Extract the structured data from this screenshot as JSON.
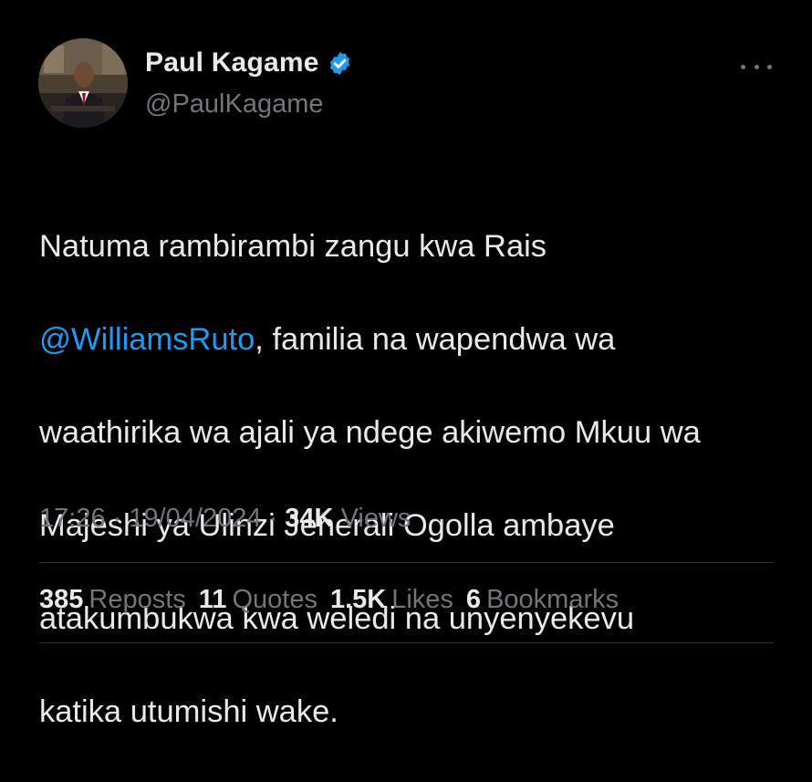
{
  "author": {
    "display_name": "Paul Kagame",
    "handle": "@PaulKagame",
    "verified_icon": "verified-badge-icon",
    "avatar_icon": "profile-photo"
  },
  "tweet": {
    "lines": [
      {
        "before": "Natuma rambirambi zangu kwa Rais",
        "mention": "",
        "after": ""
      },
      {
        "before": "",
        "mention": "@WilliamsRuto",
        "after": ", familia na wapendwa wa"
      },
      {
        "before": "waathirika wa ajali ya ndege akiwemo Mkuu wa",
        "mention": "",
        "after": ""
      },
      {
        "before": "Majeshi ya Ulinzi Jenerali Ogolla ambaye",
        "mention": "",
        "after": ""
      },
      {
        "before": "atakumbukwa kwa weledi na unyenyekevu",
        "mention": "",
        "after": ""
      },
      {
        "before": "katika utumishi wake.",
        "mention": "",
        "after": ""
      }
    ]
  },
  "meta": {
    "time": "17:26",
    "separator": "·",
    "date": "19/04/2024",
    "views_count": "34K",
    "views_label": "Views"
  },
  "stats": {
    "reposts_count": "385",
    "reposts_label": "Reposts",
    "quotes_count": "11",
    "quotes_label": "Quotes",
    "likes_count": "1.5K",
    "likes_label": "Likes",
    "bookmarks_count": "6",
    "bookmarks_label": "Bookmarks"
  },
  "colors": {
    "background": "#000000",
    "text": "#e7e9ea",
    "secondary": "#71767b",
    "link": "#1d9bf0",
    "divider": "#2f3336"
  }
}
